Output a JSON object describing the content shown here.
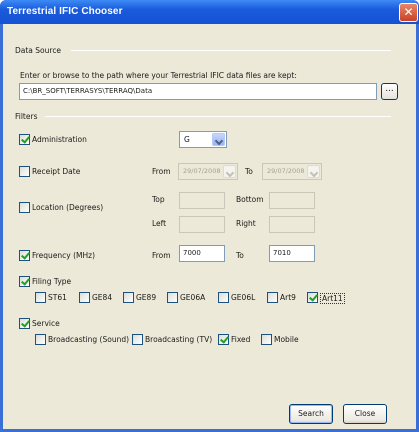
{
  "window": {
    "title": "Terrestrial IFIC Chooser",
    "close_glyph": "✕"
  },
  "data_source": {
    "label": "Data Source",
    "prompt": "Enter or browse to the path where your Terrestrial IFIC  data files are kept:",
    "path_value": "C:\\BR_SOFT\\TERRASYS\\TERRAQ\\Data",
    "browse_label": "..."
  },
  "filters": {
    "label": "Filters",
    "administration": {
      "label": "Administration",
      "checked": true,
      "value": "G"
    },
    "receipt_date": {
      "label": "Receipt Date",
      "checked": false,
      "from_label": "From",
      "from_value": "29/07/2008",
      "to_label": "To",
      "to_value": "29/07/2008"
    },
    "location": {
      "label": "Location (Degrees)",
      "checked": false,
      "top_label": "Top",
      "bottom_label": "Bottom",
      "left_label": "Left",
      "right_label": "Right"
    },
    "frequency": {
      "label": "Frequency (MHz)",
      "checked": true,
      "from_label": "From",
      "from_value": "7000",
      "to_label": "To",
      "to_value": "7010"
    },
    "filing_type": {
      "label": "Filing Type",
      "checked": true,
      "options": [
        {
          "label": "ST61",
          "checked": false
        },
        {
          "label": "GE84",
          "checked": false
        },
        {
          "label": "GE89",
          "checked": false
        },
        {
          "label": "GE06A",
          "checked": false
        },
        {
          "label": "GE06L",
          "checked": false
        },
        {
          "label": "Art9",
          "checked": false
        },
        {
          "label": "Art11",
          "checked": true
        }
      ]
    },
    "service": {
      "label": "Service",
      "checked": true,
      "options": [
        {
          "label": "Broadcasting (Sound)",
          "checked": false
        },
        {
          "label": "Broadcasting (TV)",
          "checked": false
        },
        {
          "label": "Fixed",
          "checked": true
        },
        {
          "label": "Mobile",
          "checked": false
        }
      ]
    }
  },
  "buttons": {
    "search": "Search",
    "close": "Close"
  }
}
